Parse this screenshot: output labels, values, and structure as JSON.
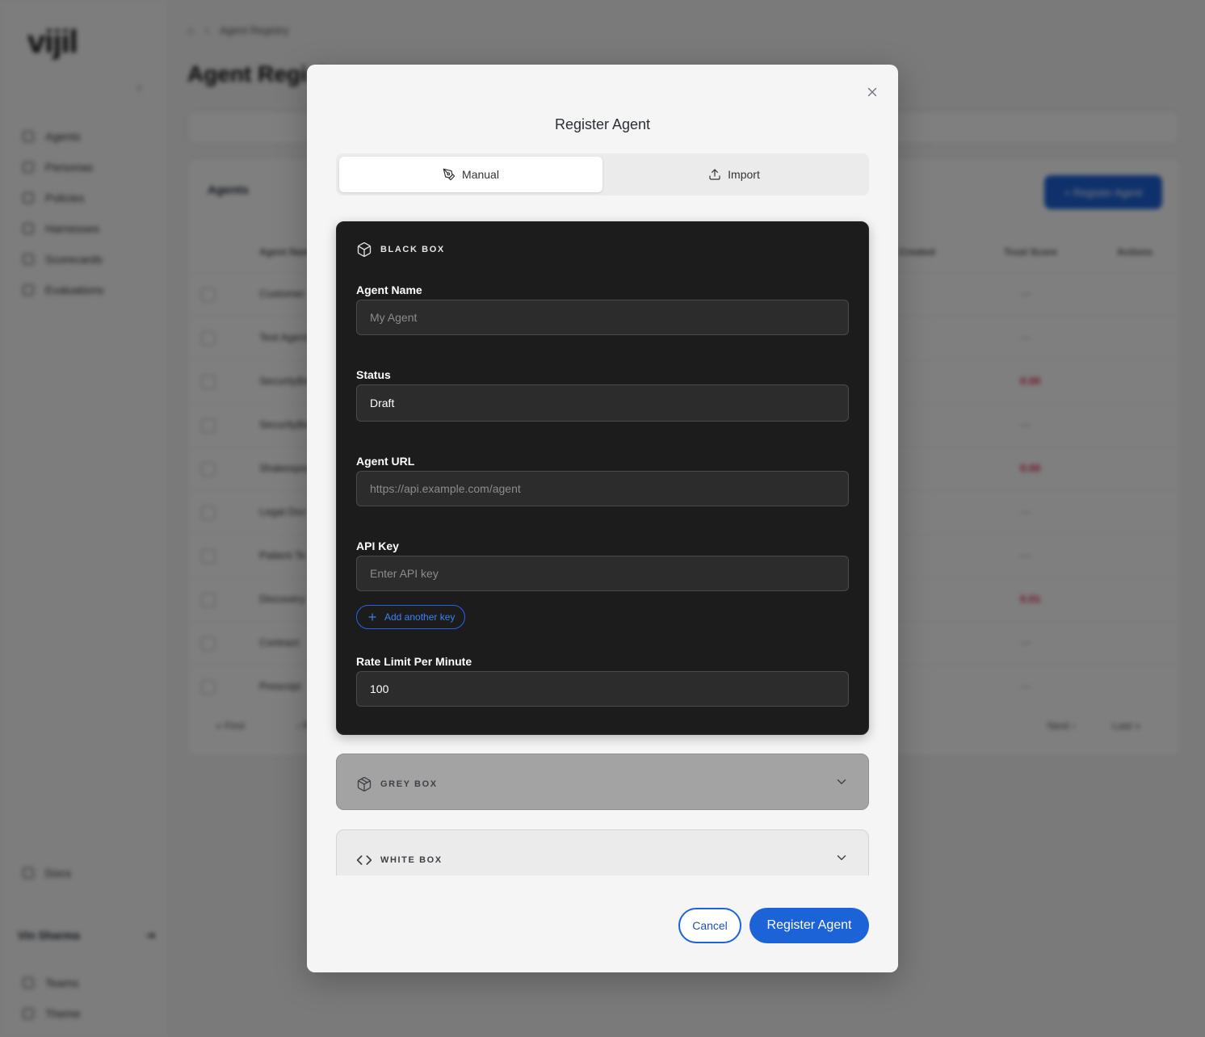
{
  "background": {
    "logo": "vijil",
    "breadcrumb": [
      "Agent Registry"
    ],
    "page_title": "Agent Registry",
    "nav_items": [
      "Agents",
      "Personas",
      "Policies",
      "Harnesses",
      "Scorecards",
      "Evaluations"
    ],
    "nav_bottom": [
      "Docs"
    ],
    "user": "Vin Sharma",
    "footer_items": [
      "Teams",
      "Theme"
    ],
    "card_tab": "Agents",
    "register_button": "+ Register Agent",
    "table_headers": [
      "Agent Name",
      "Created",
      "Trust Score",
      "Actions"
    ],
    "rows": [
      {
        "name": "Customer",
        "score": "—"
      },
      {
        "name": "Test Agent",
        "score": "—"
      },
      {
        "name": "SecurityBot",
        "score": "0.00"
      },
      {
        "name": "SecurityBot",
        "score": "—"
      },
      {
        "name": "Shakespeare",
        "score": "0.00"
      },
      {
        "name": "Legal Doc",
        "score": "—"
      },
      {
        "name": "Patient Te",
        "score": "—"
      },
      {
        "name": "Discovery",
        "score": "0.01"
      },
      {
        "name": "Contract",
        "score": "—"
      },
      {
        "name": "Prescript",
        "score": "—"
      }
    ],
    "pager": {
      "first": "« First",
      "prev": "‹ Prev",
      "next": "Next ›",
      "last": "Last »"
    }
  },
  "modal": {
    "title": "Register Agent",
    "tabs": [
      {
        "label": "Manual",
        "icon": "pen-tool-icon",
        "active": true
      },
      {
        "label": "Import",
        "icon": "upload-icon",
        "active": false
      }
    ],
    "black_box": {
      "heading": "BLACK BOX",
      "icon": "box-icon",
      "agent_name": {
        "label": "Agent Name",
        "placeholder": "My Agent",
        "value": ""
      },
      "status": {
        "label": "Status",
        "value": "Draft"
      },
      "agent_url": {
        "label": "Agent URL",
        "placeholder": "https://api.example.com/agent",
        "value": ""
      },
      "api_key": {
        "label": "API Key",
        "placeholder": "Enter API key",
        "value": ""
      },
      "add_key_label": "Add another key",
      "rate_limit": {
        "label": "Rate Limit Per Minute",
        "value": "100"
      }
    },
    "grey_box": {
      "heading": "GREY BOX",
      "icon": "package-icon"
    },
    "white_box": {
      "heading": "WHITE BOX",
      "icon": "code-icon"
    },
    "cancel_label": "Cancel",
    "submit_label": "Register Agent"
  },
  "colors": {
    "accent": "#1d63d8",
    "black_box_bg": "#1c1c1c",
    "grey_box_bg": "#a3a3a3",
    "danger": "#e11d48"
  }
}
